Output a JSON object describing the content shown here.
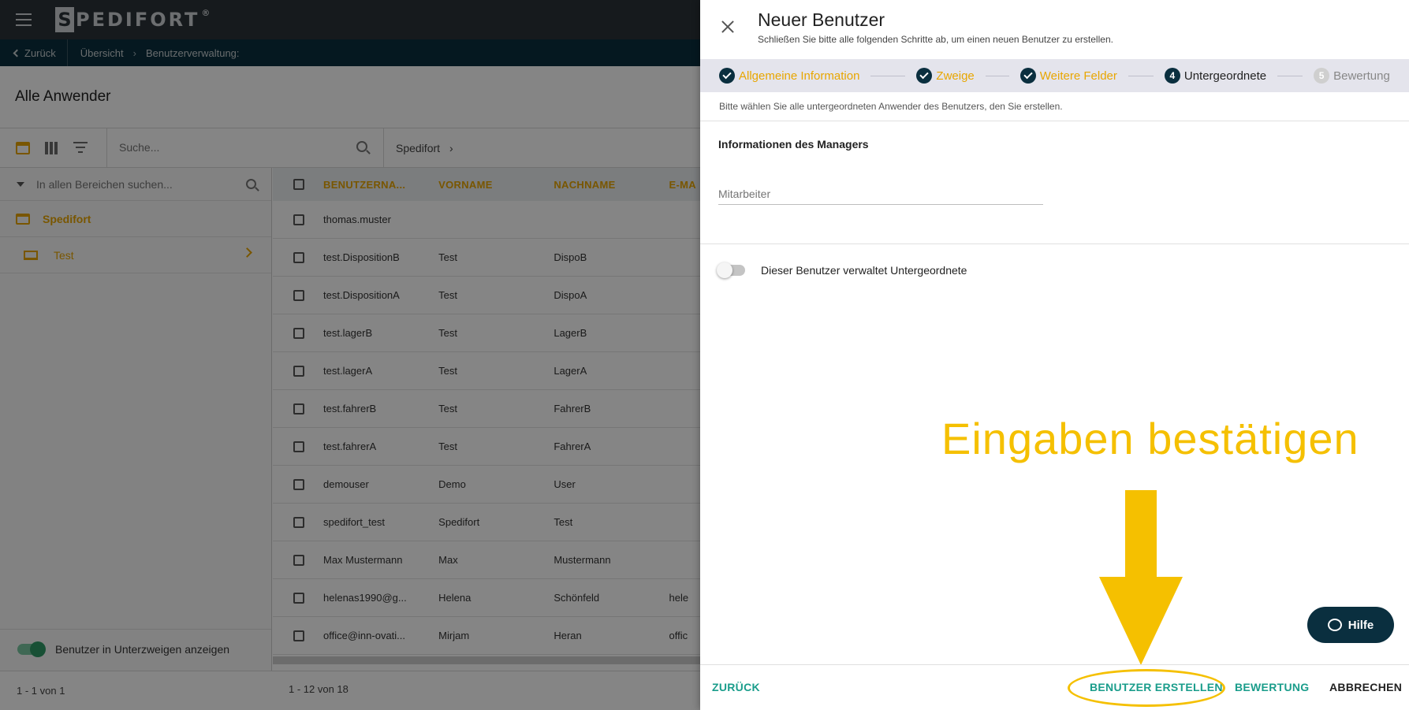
{
  "header": {
    "logo_letter": "S",
    "logo_text": "PEDIFORT",
    "logo_reg": "®"
  },
  "breadcrumb": {
    "back_label": "Zurück",
    "items": [
      "Übersicht",
      "Benutzerverwaltung:"
    ]
  },
  "page": {
    "title": "Alle Anwender"
  },
  "toolbar": {
    "search_placeholder": "Suche...",
    "crumb": "Spedifort"
  },
  "tree": {
    "search_placeholder": "In allen Bereichen suchen...",
    "root": "Spedifort",
    "child": "Test",
    "show_sub_label": "Benutzer in Unterzweigen anzeigen",
    "pager": "1 - 1 von 1"
  },
  "table": {
    "columns": [
      "BENUTZERNA...",
      "VORNAME",
      "NACHNAME",
      "E-MA"
    ],
    "rows": [
      [
        "thomas.muster",
        "",
        "",
        ""
      ],
      [
        "test.DispositionB",
        "Test",
        "DispoB",
        ""
      ],
      [
        "test.DispositionA",
        "Test",
        "DispoA",
        ""
      ],
      [
        "test.lagerB",
        "Test",
        "LagerB",
        ""
      ],
      [
        "test.lagerA",
        "Test",
        "LagerA",
        ""
      ],
      [
        "test.fahrerB",
        "Test",
        "FahrerB",
        ""
      ],
      [
        "test.fahrerA",
        "Test",
        "FahrerA",
        ""
      ],
      [
        "demouser",
        "Demo",
        "User",
        ""
      ],
      [
        "spedifort_test",
        "Spedifort",
        "Test",
        ""
      ],
      [
        "Max Mustermann",
        "Max",
        "Mustermann",
        ""
      ],
      [
        "helenas1990@g...",
        "Helena",
        "Schönfeld",
        "hele"
      ],
      [
        "office@inn-ovati...",
        "Mirjam",
        "Heran",
        "offic"
      ]
    ],
    "pager": "1 - 12 von 18"
  },
  "panel": {
    "title": "Neuer Benutzer",
    "subtitle": "Schließen Sie bitte alle folgenden Schritte ab, um einen neuen Benutzer zu erstellen.",
    "steps": [
      {
        "num": "",
        "label": "Allgemeine Information",
        "state": "done"
      },
      {
        "num": "",
        "label": "Zweige",
        "state": "done"
      },
      {
        "num": "",
        "label": "Weitere Felder",
        "state": "done"
      },
      {
        "num": "4",
        "label": "Untergeordnete",
        "state": "active"
      },
      {
        "num": "5",
        "label": "Bewertung",
        "state": "todo"
      }
    ],
    "hint": "Bitte wählen Sie alle untergeordneten Anwender des Benutzers, den Sie erstellen.",
    "section_title": "Informationen des Managers",
    "field_placeholder": "Mitarbeiter",
    "toggle_label": "Dieser Benutzer verwaltet Untergeordnete",
    "annotation": "Eingaben bestätigen",
    "help_label": "Hilfe",
    "buttons": {
      "back": "ZURÜCK",
      "create": "BENUTZER ERSTELLEN",
      "review": "BEWERTUNG",
      "cancel": "ABBRECHEN"
    }
  },
  "colors": {
    "accent": "#e8a600",
    "navy": "#0a2f3f",
    "teal": "#1a9d8b",
    "annotation": "#f5c000"
  }
}
